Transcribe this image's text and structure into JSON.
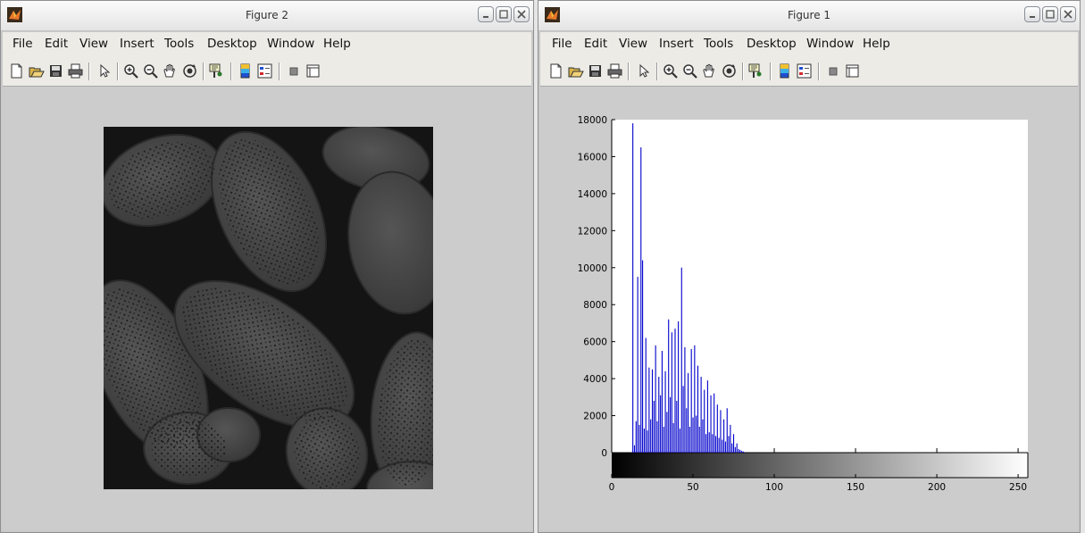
{
  "windows": [
    {
      "title": "Figure 2",
      "menus": [
        "File",
        "Edit",
        "View",
        "Insert",
        "Tools",
        "Desktop",
        "Window",
        "Help"
      ]
    },
    {
      "title": "Figure 1",
      "menus": [
        "File",
        "Edit",
        "View",
        "Insert",
        "Tools",
        "Desktop",
        "Window",
        "Help"
      ]
    }
  ],
  "toolbar_icons": [
    "new-figure-icon",
    "open-file-icon",
    "save-icon",
    "print-icon",
    "edit-plot-arrow-icon",
    "zoom-in-icon",
    "zoom-out-icon",
    "pan-hand-icon",
    "rotate-3d-icon",
    "data-cursor-icon",
    "insert-colorbar-icon",
    "insert-legend-icon",
    "hide-plot-tools-icon",
    "show-plot-tools-icon"
  ],
  "colors": {
    "bar": "#0000cc",
    "window_bg": "#c9c9c9",
    "menu_bg": "#ecebe6"
  },
  "chart_data": {
    "type": "bar",
    "title": "",
    "xlabel": "",
    "ylabel": "",
    "xlim": [
      0,
      256
    ],
    "ylim": [
      0,
      18000
    ],
    "xticks": [
      0,
      50,
      100,
      150,
      200,
      250
    ],
    "yticks": [
      0,
      2000,
      4000,
      6000,
      8000,
      10000,
      12000,
      14000,
      16000,
      18000
    ],
    "colorbar": "grayscale 0-255 below axis",
    "bins": [
      13,
      14,
      15,
      16,
      17,
      18,
      19,
      20,
      21,
      22,
      23,
      24,
      25,
      26,
      27,
      28,
      29,
      30,
      31,
      32,
      33,
      34,
      35,
      36,
      37,
      38,
      39,
      40,
      41,
      42,
      43,
      44,
      45,
      46,
      47,
      48,
      49,
      50,
      51,
      52,
      53,
      54,
      55,
      56,
      57,
      58,
      59,
      60,
      61,
      62,
      63,
      64,
      65,
      66,
      67,
      68,
      69,
      70,
      71,
      72,
      73,
      74,
      75,
      76,
      77,
      78,
      79,
      80,
      81,
      82
    ],
    "values": [
      17800,
      400,
      1700,
      9500,
      1500,
      16500,
      10400,
      1300,
      6200,
      1200,
      4600,
      1800,
      4500,
      2800,
      5800,
      1700,
      4100,
      3100,
      5500,
      1400,
      4400,
      2200,
      7200,
      3000,
      6500,
      1600,
      6700,
      2800,
      7100,
      1300,
      10000,
      3600,
      5700,
      2400,
      4300,
      1400,
      5600,
      1900,
      5800,
      2000,
      4700,
      1400,
      4100,
      1800,
      3400,
      1000,
      3900,
      1100,
      3100,
      1000,
      3200,
      900,
      2600,
      800,
      2300,
      700,
      1800,
      600,
      2400,
      900,
      1500,
      500,
      1000,
      300,
      500,
      200,
      150,
      100,
      60,
      30
    ]
  }
}
